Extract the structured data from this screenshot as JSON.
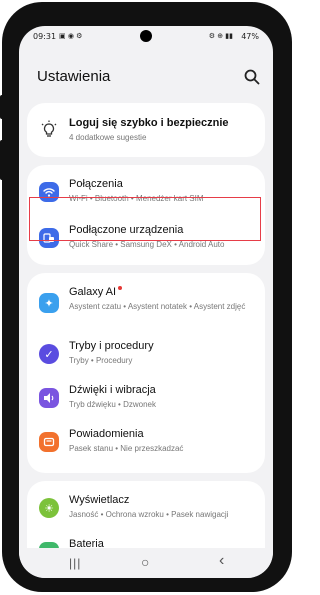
{
  "status": {
    "time": "09:31",
    "battery": "47%",
    "icons_left": "▣ ◉ ⚙",
    "icons_right": "⚙ ⊕ ▮▮"
  },
  "header": {
    "title": "Ustawienia"
  },
  "suggestion": {
    "title": "Loguj się szybko i bezpiecznie",
    "subtitle": "4 dodatkowe sugestie"
  },
  "items": [
    {
      "label": "Połączenia",
      "sub": "Wi-Fi  •  Bluetooth  •  Menedżer kart SIM",
      "color": "#3d6be8",
      "icon": "wifi-icon"
    },
    {
      "label": "Podłączone urządzenia",
      "sub": "Quick Share  •  Samsung DeX  •  Android Auto",
      "color": "#3d6be8",
      "icon": "devices-icon"
    },
    {
      "label": "Galaxy AI",
      "sub": "Asystent czatu  •  Asystent notatek  •  Asystent zdjęć",
      "color": "#3aa0ee",
      "icon": "sparkle-icon"
    },
    {
      "label": "Tryby i procedury",
      "sub": "Tryby  •  Procedury",
      "color": "#5a4ce0",
      "icon": "check-icon"
    },
    {
      "label": "Dźwięki i wibracja",
      "sub": "Tryb dźwięku  •  Dzwonek",
      "color": "#7a55e0",
      "icon": "speaker-icon"
    },
    {
      "label": "Powiadomienia",
      "sub": "Pasek stanu  •  Nie przeszkadzać",
      "color": "#f2712d",
      "icon": "bell-icon"
    },
    {
      "label": "Wyświetlacz",
      "sub": "Jasność  •  Ochrona wzroku  •  Pasek nawigacji",
      "color": "#7cc23a",
      "icon": "sun-icon"
    },
    {
      "label": "Bateria",
      "sub": "",
      "color": "#3fb86a",
      "icon": "battery-icon"
    }
  ],
  "nav": {
    "recents": "|||",
    "home": "○",
    "back": "‹"
  }
}
